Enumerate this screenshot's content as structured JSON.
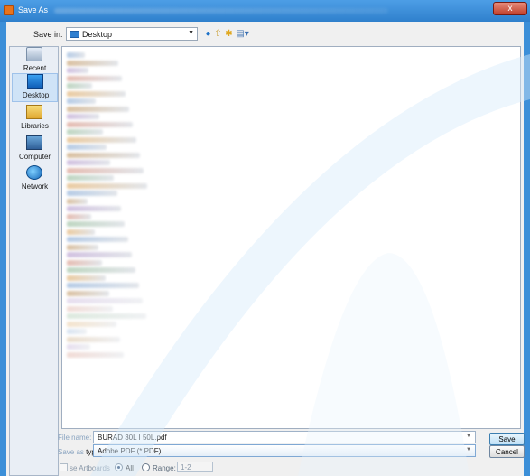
{
  "window": {
    "title": "Save As",
    "close_glyph": "x"
  },
  "save_in": {
    "label": "Save in:",
    "value": "Desktop",
    "icon": "folder-icon"
  },
  "toolbar": {
    "icons": [
      "back-icon",
      "up-folder-icon",
      "new-folder-icon",
      "view-menu-icon"
    ]
  },
  "places": [
    {
      "label": "Recent Places",
      "icon": "recent-places-icon"
    },
    {
      "label": "Desktop",
      "icon": "desktop-icon",
      "active": true
    },
    {
      "label": "Libraries",
      "icon": "libraries-icon"
    },
    {
      "label": "Computer",
      "icon": "computer-icon"
    },
    {
      "label": "Network",
      "icon": "network-icon"
    }
  ],
  "file_name": {
    "label": "File name:",
    "value": "BURAD 30L I 50L.pdf"
  },
  "file_type": {
    "label_prefix": "Save as ",
    "label_emph": "type:",
    "value": "Adobe PDF (*.PDF)"
  },
  "buttons": {
    "save": "Save",
    "cancel": "Cancel"
  },
  "options": {
    "artboards_label": "se Artboards",
    "all_label": "All",
    "range_label": "Range:",
    "range_value": "1-2"
  },
  "colors": {
    "accent": "#2f80cc",
    "selection": "#cfe3f7"
  }
}
